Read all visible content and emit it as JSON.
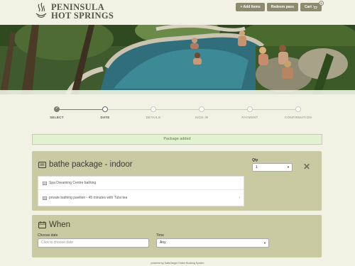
{
  "header": {
    "logo_line1": "PENINSULA",
    "logo_line2": "HOT SPRINGS",
    "add_items_label": "+ Add Items",
    "redeem_pass_label": "Redeem pass",
    "cart_label": "Cart",
    "cart_icon": "cart-icon",
    "cart_count": "0"
  },
  "colors": {
    "background": "#f1f2e4",
    "panel": "#c9c9a2",
    "button": "#8c8b6f",
    "alert_bg": "#e2f1d2",
    "alert_text": "#5c7a45"
  },
  "progress": {
    "steps": [
      {
        "label": "SELECT",
        "state": "done"
      },
      {
        "label": "DATE",
        "state": "current"
      },
      {
        "label": "DETAILS",
        "state": "pending"
      },
      {
        "label": "SIGN IN",
        "state": "pending"
      },
      {
        "label": "PAYMENT",
        "state": "pending"
      },
      {
        "label": "CONFIRMATION",
        "state": "pending"
      }
    ]
  },
  "alert": {
    "text": "Package added"
  },
  "package": {
    "icon": "list-icon",
    "title": "bathe package - indoor",
    "qty_label": "Qty",
    "qty_value": "1",
    "remove_icon": "close-icon",
    "items": [
      {
        "icon": "list-icon",
        "label": "Spa Dreaming Centre bathing"
      },
      {
        "icon": "list-icon",
        "label": "private bathing pavilion - 45 minutes with Tulsi tea",
        "chevron": "›"
      }
    ]
  },
  "when": {
    "icon": "calendar-icon",
    "title": "When",
    "date_label": "Choose date",
    "date_placeholder": "Click to choose date",
    "time_label": "Time",
    "time_value": "Any"
  },
  "footer": {
    "text": "powered by SalesTarget Online Booking System"
  }
}
